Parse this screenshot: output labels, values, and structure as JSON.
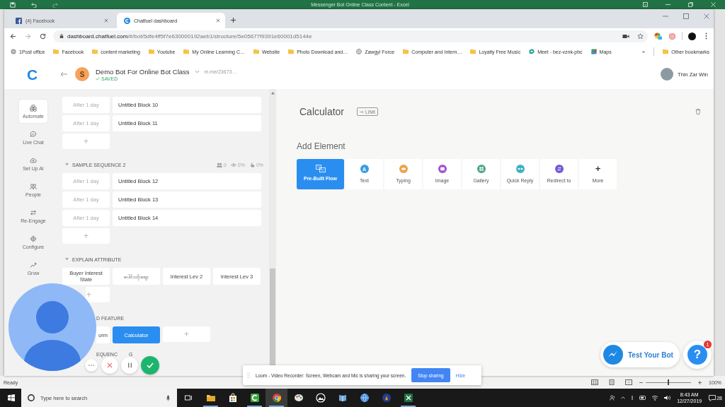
{
  "excel": {
    "title": "Messenger Bot Online Class Content - Excel",
    "status": "Ready",
    "zoom_slider": {
      "level": 0.5
    },
    "zoom": "100%"
  },
  "browser": {
    "tabs": [
      {
        "title": "(4) Facebook",
        "selected": false
      },
      {
        "title": "Chatfuel dashboard",
        "selected": true
      }
    ],
    "url": {
      "host": "dashboard.chatfuel.com",
      "path": "/#/bot/5dfe4ff5f7e630000192aeb1/structure/5e05677f9391e60001d5144e"
    },
    "bookmarks": [
      {
        "label": "1Post office",
        "kind": "site"
      },
      {
        "label": "Facebook",
        "kind": "folder"
      },
      {
        "label": "content marketing",
        "kind": "folder"
      },
      {
        "label": "Youtube",
        "kind": "folder"
      },
      {
        "label": "My Online Learning C…",
        "kind": "folder"
      },
      {
        "label": "Website",
        "kind": "folder"
      },
      {
        "label": "Photo Download and…",
        "kind": "folder"
      },
      {
        "label": "Zawgyi Force",
        "kind": "globe"
      },
      {
        "label": "Computer and Intern…",
        "kind": "folder"
      },
      {
        "label": "Loyalty Free Music",
        "kind": "folder"
      },
      {
        "label": "Meet - bez-vznk-pbc",
        "kind": "meet"
      },
      {
        "label": "Maps",
        "kind": "maps"
      }
    ],
    "overflow": "»",
    "other_bookmarks": "Other bookmarks"
  },
  "header": {
    "logo": "C",
    "bot_initial": "S",
    "bot_name": "Demo Bot For Online Bot Class",
    "bot_link": "m.me/23673…",
    "saved": "SAVED",
    "user": "Thin Zar Win"
  },
  "nav": [
    {
      "label": "Automate",
      "selected": true
    },
    {
      "label": "Live Chat",
      "selected": false
    },
    {
      "label": "Set Up AI",
      "selected": false
    },
    {
      "label": "People",
      "selected": false
    },
    {
      "label": "Re-Engage",
      "selected": false
    },
    {
      "label": "Configure",
      "selected": false
    },
    {
      "label": "Grow",
      "selected": false
    }
  ],
  "sections": [
    {
      "kind": "sequence",
      "rows": [
        {
          "delay": "After 1 day",
          "block": "Untitled Block 10"
        },
        {
          "delay": "After 1 day",
          "block": "Untitled Block 11"
        }
      ],
      "add": {
        "label": "+",
        "partly_hidden": false
      }
    },
    {
      "kind": "sequence",
      "title": "SAMPLE SEQUENCE 2",
      "stats": [
        "0",
        "0%",
        "0%"
      ],
      "rows": [
        {
          "delay": "After 1 day",
          "block": "Untitled Block 12"
        },
        {
          "delay": "After 1 day",
          "block": "Untitled Block 13"
        },
        {
          "delay": "After 1 day",
          "block": "Untitled Block 14"
        }
      ],
      "add": {
        "label": "+",
        "partly_hidden": false
      }
    },
    {
      "kind": "group",
      "title": "EXPLAIN ATTRIBUTE",
      "cards": [
        {
          "label": "Buyer Interest State",
          "selected": false,
          "partly_hidden": false
        },
        {
          "label": "ပေါင်းထိုးဈေး",
          "selected": false,
          "partly_hidden": false
        },
        {
          "label": "Interest Lev 2",
          "selected": false,
          "partly_hidden": false
        },
        {
          "label": "Interest Lev 3",
          "selected": false,
          "partly_hidden": false
        }
      ],
      "add": {
        "label": "+",
        "partly_hidden": true
      }
    },
    {
      "kind": "group",
      "title": "D FEATURE",
      "partly_hidden": true,
      "cards": [
        {
          "label": "orm",
          "selected": false,
          "partly_hidden": true
        },
        {
          "label": "Calculator",
          "selected": true,
          "partly_hidden": false
        }
      ],
      "add": {
        "label": "+",
        "partly_hidden": false
      }
    },
    {
      "kind": "group",
      "title": "EQUENC",
      "title_tail": "G",
      "partly_hidden": true
    }
  ],
  "block": {
    "title": "Calculator",
    "link": "LINK",
    "add_title": "Add Element",
    "elements": [
      {
        "label": "Pre-Built Flow",
        "kind": "flow"
      },
      {
        "label": "Text",
        "kind": "letter",
        "glyph": "A",
        "color": "#3b9de0"
      },
      {
        "label": "Typing",
        "kind": "dot",
        "color": "#efa248"
      },
      {
        "label": "Image",
        "kind": "dot",
        "color": "#a052d4"
      },
      {
        "label": "Gallery",
        "kind": "dot",
        "color": "#4da581"
      },
      {
        "label": "Quick Reply",
        "kind": "dot",
        "color": "#40b2c4"
      },
      {
        "label": "Redirect to",
        "kind": "dot",
        "color": "#7558d6"
      },
      {
        "label": "More",
        "kind": "plus",
        "glyph": "+"
      }
    ]
  },
  "test_bot": {
    "label": "Test Your Bot"
  },
  "help": {
    "glyph": "?",
    "badge": "1"
  },
  "loom": {
    "message": "Loom - Video Recorder: Screen, Webcam and Mic is sharing your screen.",
    "stop": "Stop sharing",
    "hide": "Hide"
  },
  "taskbar": {
    "search": {
      "placeholder": "Type here to search"
    },
    "apps": [
      {
        "running": true,
        "selected": false
      },
      {
        "running": false,
        "selected": false
      },
      {
        "running": true,
        "selected": false
      },
      {
        "running": true,
        "selected": true
      },
      {
        "running": false,
        "selected": false
      },
      {
        "running": false,
        "selected": false
      },
      {
        "running": false,
        "selected": false
      },
      {
        "running": false,
        "selected": false
      },
      {
        "running": false,
        "selected": false
      },
      {
        "running": true,
        "selected": false
      }
    ],
    "time": "8:43 AM",
    "date": "12/27/2019",
    "notifications": "28"
  }
}
